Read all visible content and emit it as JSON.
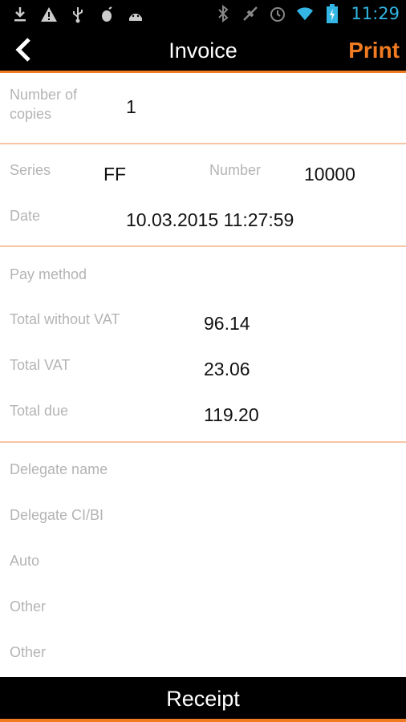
{
  "status_bar": {
    "time": "11:29",
    "left_icons": [
      "download-icon",
      "warning-icon",
      "usb-icon",
      "bug-icon",
      "android-icon"
    ],
    "right_icons": [
      "bluetooth-icon",
      "gps-icon",
      "alarm-icon",
      "wifi-icon",
      "battery-charging-icon"
    ],
    "time_color": "#33b5e5"
  },
  "header": {
    "title": "Invoice",
    "print_label": "Print",
    "accent": "#f07b22"
  },
  "copies": {
    "label": "Number of copies",
    "value": "1"
  },
  "document": {
    "series_label": "Series",
    "series_value": "FF",
    "number_label": "Number",
    "number_value": "10000",
    "date_label": "Date",
    "date_value": "10.03.2015 11:27:59"
  },
  "payment": {
    "pay_method_label": "Pay method",
    "total_without_vat_label": "Total without VAT",
    "total_without_vat_value": "96.14",
    "total_vat_label": "Total VAT",
    "total_vat_value": "23.06",
    "total_due_label": "Total due",
    "total_due_value": "119.20"
  },
  "delegate": {
    "name_label": "Delegate name",
    "ci_label": "Delegate CI/BI",
    "auto_label": "Auto",
    "other1_label": "Other",
    "other2_label": "Other"
  },
  "footer": {
    "receipt_label": "Receipt"
  }
}
